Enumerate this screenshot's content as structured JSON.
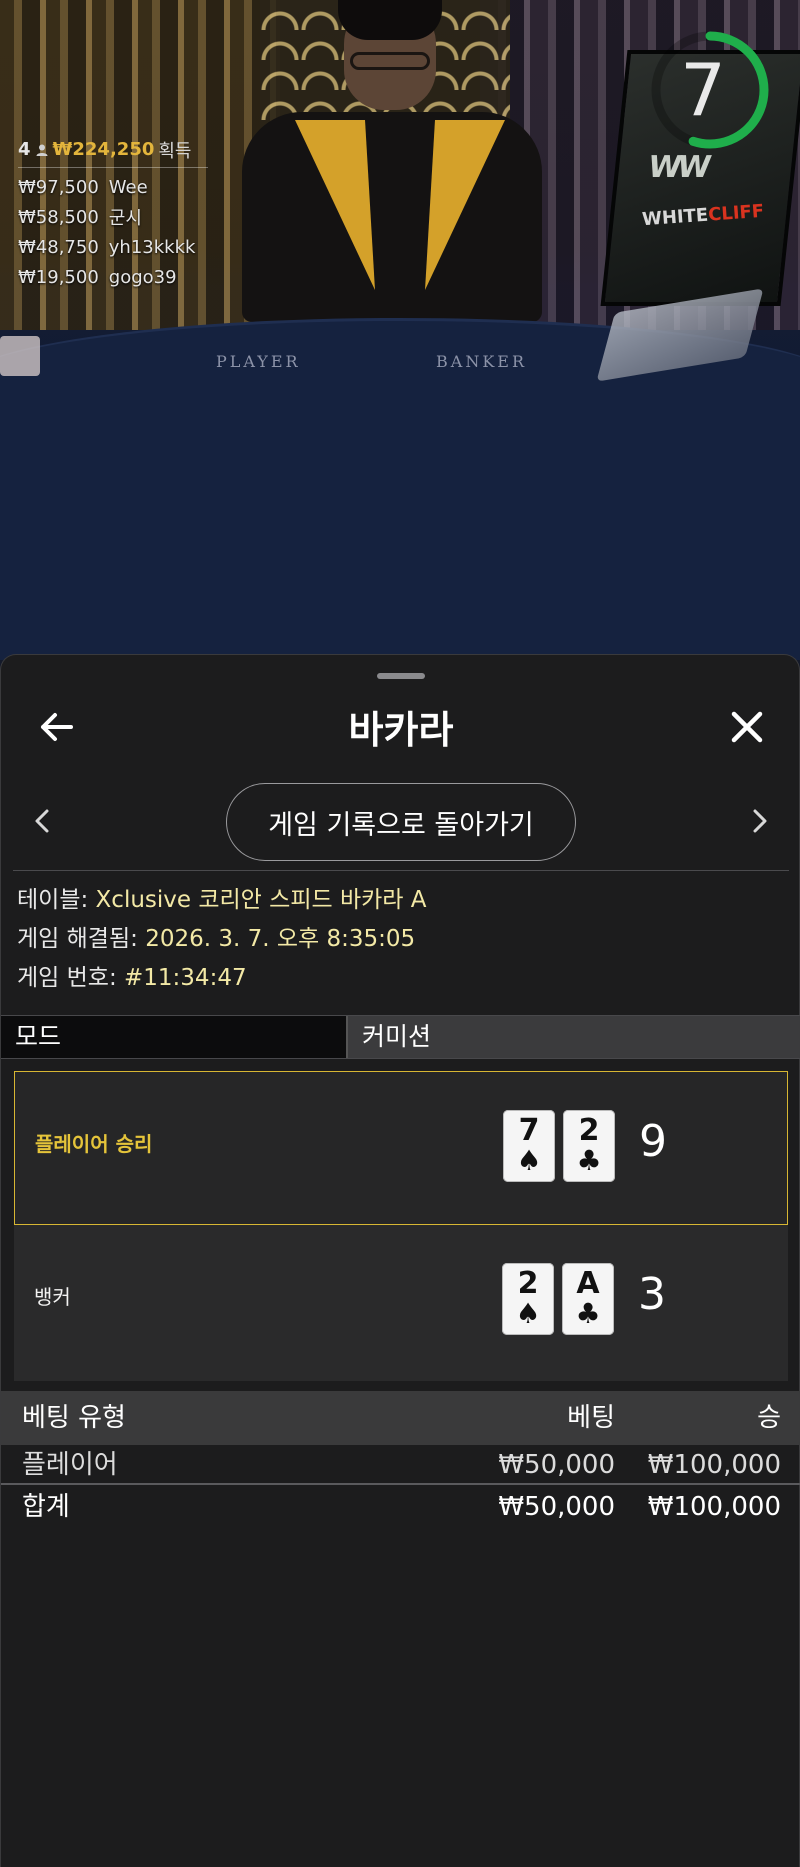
{
  "video": {
    "timer_value": "7",
    "timer_fraction": 0.55,
    "timer_color": "#1fae4b",
    "felt_player": "PLAYER",
    "felt_banker": "BANKER",
    "brand_part1": "WHITE",
    "brand_part2": "CLIFF",
    "winners": {
      "count": "4",
      "total": "₩224,250",
      "label": "획득",
      "list": [
        {
          "amount": "₩97,500",
          "name": "Wee"
        },
        {
          "amount": "₩58,500",
          "name": "군시"
        },
        {
          "amount": "₩48,750",
          "name": "yh13kkkk"
        },
        {
          "amount": "₩19,500",
          "name": "gogo39"
        }
      ]
    }
  },
  "sheet": {
    "title": "바카라",
    "history_button": "게임 기록으로 돌아가기",
    "info": {
      "table_label": "테이블:",
      "table_value": "Xclusive 코리안 스피드 바카라 A",
      "resolved_label": "게임 해결됨:",
      "resolved_value": "2026. 3. 7. 오후 8:35:05",
      "number_label": "게임 번호:",
      "number_value": "#11:34:47"
    },
    "mode_label": "모드",
    "commission_label": "커미션",
    "results": [
      {
        "label": "플레이어 승리",
        "winner": true,
        "cards": [
          {
            "rank": "7",
            "suit": "♠"
          },
          {
            "rank": "2",
            "suit": "♣"
          }
        ],
        "score": "9"
      },
      {
        "label": "뱅커",
        "winner": false,
        "cards": [
          {
            "rank": "2",
            "suit": "♠"
          },
          {
            "rank": "A",
            "suit": "♣"
          }
        ],
        "score": "3"
      }
    ],
    "bets_table": {
      "headers": {
        "type": "베팅 유형",
        "bet": "베팅",
        "win": "승"
      },
      "rows": [
        {
          "type": "플레이어",
          "bet": "₩50,000",
          "win": "₩100,000"
        }
      ],
      "total": {
        "type": "합계",
        "bet": "₩50,000",
        "win": "₩100,000"
      }
    }
  },
  "colors": {
    "accent_gold": "#e5c43a",
    "info_value": "#f3e9a6",
    "sheet_bg": "#1c1c1d"
  }
}
